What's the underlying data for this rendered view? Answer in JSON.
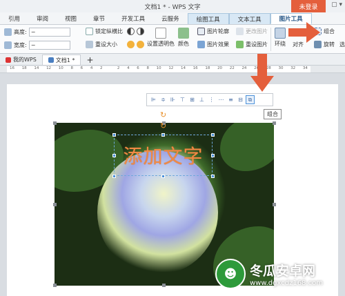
{
  "window": {
    "title": "文档1 * - WPS 文字",
    "login_label": "未登录",
    "controls": "▢ ▾"
  },
  "menu": {
    "items": [
      "引用",
      "审阅",
      "视图",
      "章节",
      "开发工具",
      "云服务",
      "绘图工具",
      "文本工具",
      "图片工具"
    ],
    "active_index": 8
  },
  "ribbon": {
    "height_label": "高度:",
    "height_value": "−",
    "width_label": "宽度:",
    "width_value": "−",
    "lock_ratio": "锁定纵横比",
    "reset_size": "重设大小",
    "set_transparent": "设置透明色",
    "color_label": "颜色",
    "picture_outline": "图片轮廓",
    "picture_effect": "图片效果",
    "change_picture": "更改图片",
    "reset_picture": "重设图片",
    "wrap_label": "环绕",
    "align_label": "对齐",
    "group_label": "组合",
    "rotate_label": "旋转",
    "cut_label": "选"
  },
  "tabs": {
    "home_tab": "我的WPS",
    "doc_tab": "文档1 *",
    "add_tab": "+"
  },
  "ruler": {
    "ticks": [
      "16",
      "18",
      "14",
      "12",
      "10",
      "8",
      "6",
      "4",
      "2",
      "",
      "2",
      "4",
      "6",
      "8",
      "10",
      "12",
      "14",
      "16",
      "18",
      "20",
      "22",
      "24",
      "26",
      "28",
      "30",
      "32",
      "34"
    ]
  },
  "canvas": {
    "textbox_text": "添加文字",
    "tooltip": "组合"
  },
  "watermark": {
    "title": "冬瓜安卓网",
    "url": "www.dgxcdz168.com"
  },
  "colors": {
    "accent_orange": "#e45f3c",
    "text_orange": "#f08a45",
    "tool_tab_blue": "#d8e8f5"
  }
}
